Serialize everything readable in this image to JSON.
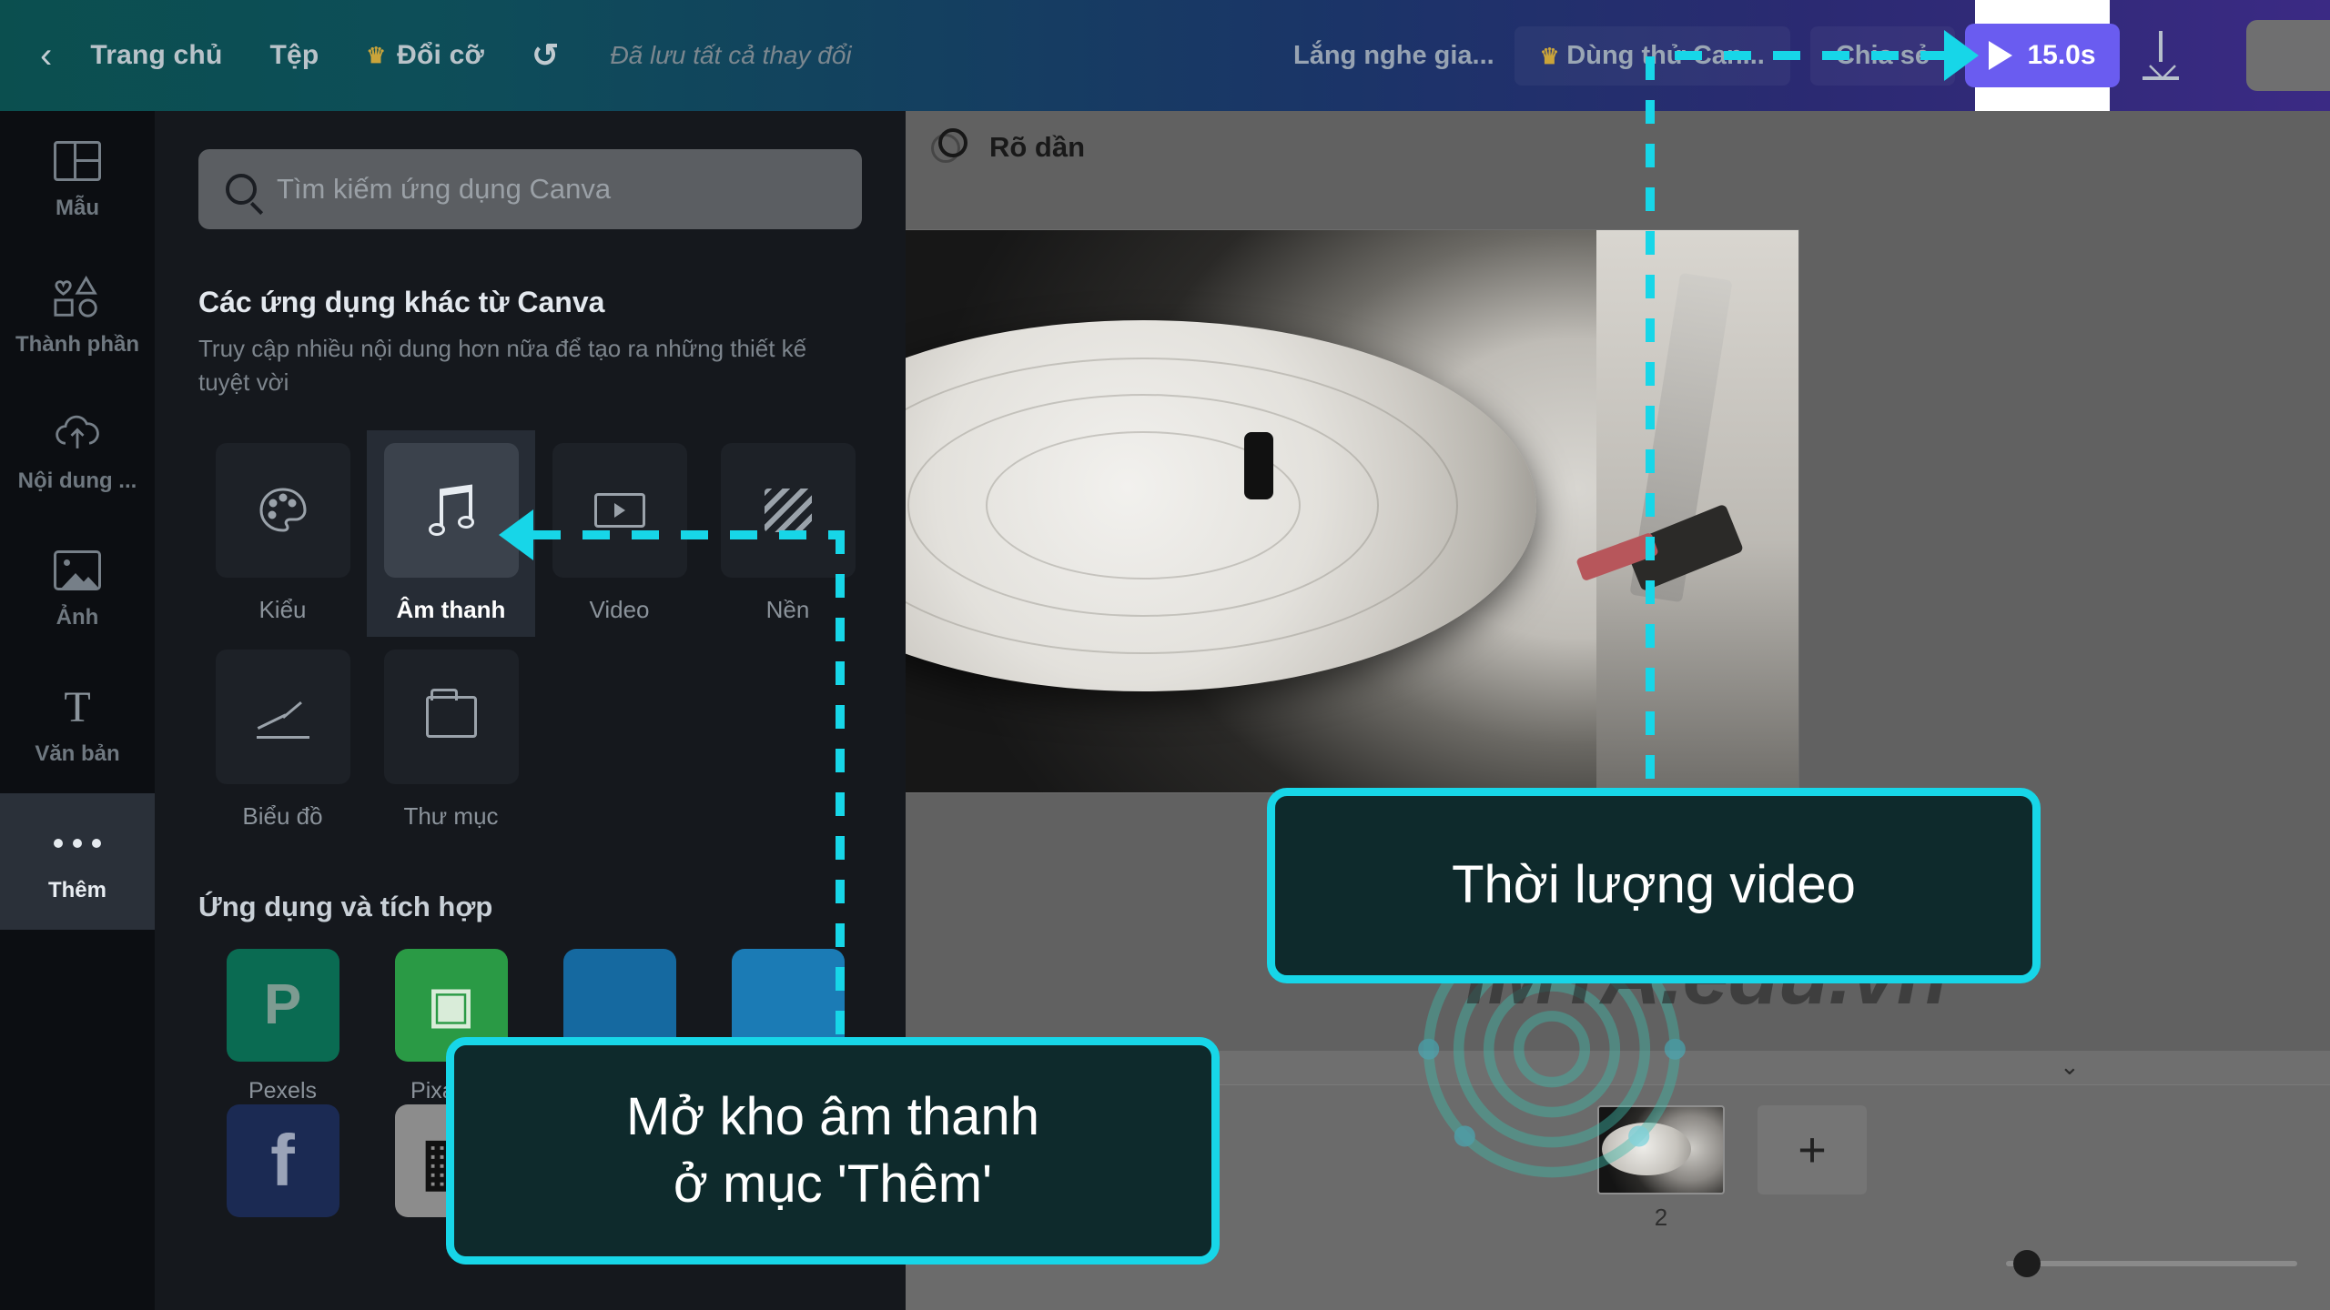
{
  "topbar": {
    "back_label": "",
    "home_label": "Trang chủ",
    "file_label": "Tệp",
    "resize_label": "Đổi cỡ",
    "undo_label": "",
    "saved_label": "Đã lưu tất cả thay đổi",
    "listening_label": "Lắng nghe gia...",
    "trial_label": "Dùng thử Can...",
    "share_label": "Chia sẻ",
    "duration_label": "15.0s",
    "download_label": "",
    "accent_purple": "#6a5cf0",
    "crown_color": "#caa43a"
  },
  "rail": {
    "items": [
      {
        "label": "Mẫu",
        "icon": "template-icon",
        "active": false
      },
      {
        "label": "Thành phần",
        "icon": "elements-icon",
        "active": false
      },
      {
        "label": "Nội dung ...",
        "icon": "upload-cloud-icon",
        "active": false
      },
      {
        "label": "Ảnh",
        "icon": "photo-icon",
        "active": false
      },
      {
        "label": "Văn bản",
        "icon": "text-icon",
        "active": false
      },
      {
        "label": "Thêm",
        "icon": "more-dots-icon",
        "active": true
      }
    ]
  },
  "panel": {
    "search_placeholder": "Tìm kiếm ứng dụng Canva",
    "search_value": "",
    "section_title": "Các ứng dụng khác từ Canva",
    "section_subtitle": "Truy cập nhiều nội dung hơn nữa để tạo ra những thiết kế tuyệt vời",
    "apps": [
      {
        "label": "Kiểu",
        "icon": "palette-icon",
        "highlighted": false
      },
      {
        "label": "Âm thanh",
        "icon": "music-note-icon",
        "highlighted": true
      },
      {
        "label": "Video",
        "icon": "video-icon",
        "highlighted": false
      },
      {
        "label": "Nền",
        "icon": "background-pattern-icon",
        "highlighted": false
      },
      {
        "label": "Biểu đồ",
        "icon": "chart-icon",
        "highlighted": false
      },
      {
        "label": "Thư mục",
        "icon": "folder-icon",
        "highlighted": false
      }
    ],
    "integrations_title": "Ứng dụng và tích hợp",
    "integrations": [
      {
        "label": "Pexels",
        "glyph": "P",
        "color": "#05a081",
        "bg": "#0a6b52"
      },
      {
        "label": "Pixabay",
        "glyph": "◉",
        "color": "#ffffff",
        "bg": "#2a9a45"
      },
      {
        "label": "",
        "glyph": "",
        "color": "#ffffff",
        "bg": "#1569a0"
      },
      {
        "label": "",
        "glyph": "",
        "color": "#ffffff",
        "bg": "#1b7bb5"
      },
      {
        "label": "",
        "glyph": "f",
        "color": "#ffffff",
        "bg": "#1b2a53"
      },
      {
        "label": "",
        "glyph": "▦",
        "color": "#111111",
        "bg": "#8c8c8c"
      },
      {
        "label": "",
        "glyph": "◠",
        "color": "#ffffff",
        "bg": "#101418"
      },
      {
        "label": "",
        "glyph": "▞",
        "color": "#ffffff",
        "bg": "#0b0b0b"
      }
    ],
    "collapse_icon": "chevron-left-icon"
  },
  "stage": {
    "effect_label": "Rõ dần",
    "effect_icon": "fade-circles-icon",
    "page_number": "2",
    "add_page_label": "+",
    "expand_icon": "chevron-down-icon",
    "prev_icon": "chevron-left-icon",
    "watermark": "IMTA.edu.vn"
  },
  "annotations": {
    "callout_audio": "Mở kho âm thanh\nở mục 'Thêm'",
    "callout_audio_line1": "Mở kho âm thanh",
    "callout_audio_line2": "ở mục 'Thêm'",
    "callout_duration": "Thời lượng video",
    "accent_color": "#17d6e8"
  }
}
